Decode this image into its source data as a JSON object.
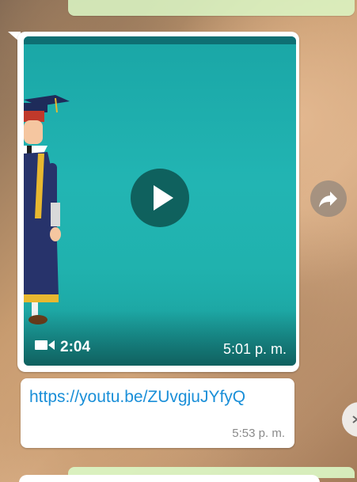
{
  "video_message": {
    "duration": "2:04",
    "time": "5:01 p. m.",
    "camera_icon": "video-camera-icon",
    "play_icon": "play-icon"
  },
  "link_message": {
    "url": "https://youtu.be/ZUvgjuJYfyQ",
    "time": "5:53 p. m."
  },
  "actions": {
    "forward_icon": "forward-share-icon"
  },
  "colors": {
    "outgoing_bubble": "#dcf8c6",
    "incoming_bubble": "#ffffff",
    "link": "#1a8fd8",
    "video_bg": "#20b2ae"
  }
}
